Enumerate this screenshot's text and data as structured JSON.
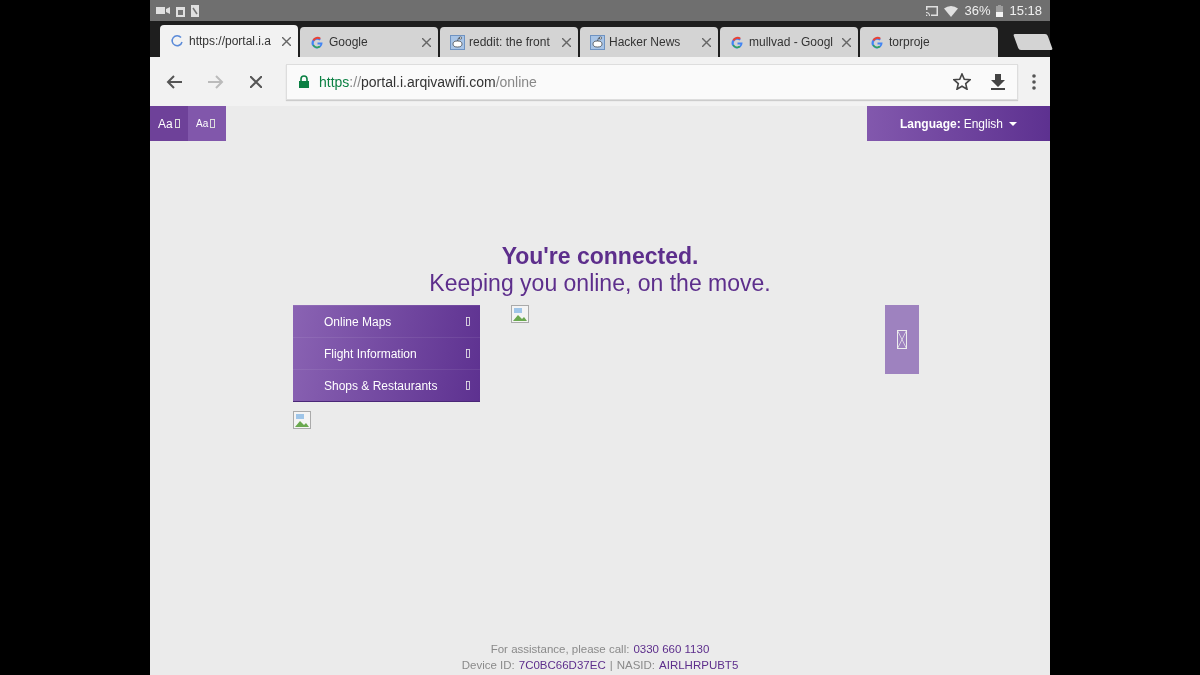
{
  "status_bar": {
    "battery": "36%",
    "time": "15:18"
  },
  "tabs": [
    {
      "title": "https://portal.i.a",
      "kind": "spinner",
      "selected": true
    },
    {
      "title": "Google",
      "kind": "google",
      "selected": false
    },
    {
      "title": "reddit: the front",
      "kind": "alien",
      "selected": false
    },
    {
      "title": "Hacker News",
      "kind": "alien",
      "selected": false
    },
    {
      "title": "mullvad - Googl",
      "kind": "google",
      "selected": false
    },
    {
      "title": "torproje",
      "kind": "google",
      "selected": false
    }
  ],
  "toolbar": {
    "loading": true,
    "url": {
      "scheme": "https",
      "separator": "://",
      "host": "portal.i.arqivawifi.com",
      "path": "/online"
    }
  },
  "page": {
    "font_buttons": [
      "Aa",
      "Aa"
    ],
    "language": {
      "label": "Language:",
      "value": "English"
    },
    "headline": "You're connected.",
    "subheadline": "Keeping you online, on the move.",
    "menu": [
      "Online Maps",
      "Flight Information",
      "Shops & Restaurants"
    ],
    "footer": {
      "assistance_label": "For assistance, please call:",
      "phone": "0330 660 1130",
      "device_label": "Device ID:",
      "device_id": "7C0BC66D37EC",
      "separator": "|",
      "nasid_label": "NASID:",
      "nasid": "AIRLHRPUBT5"
    }
  }
}
